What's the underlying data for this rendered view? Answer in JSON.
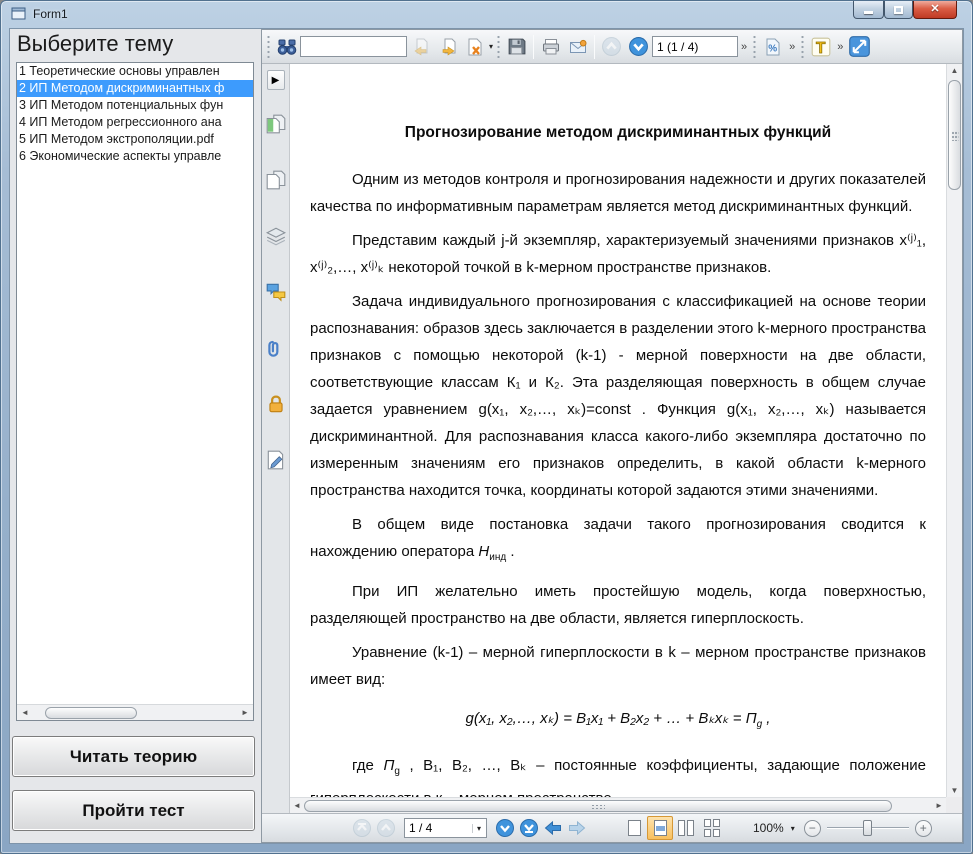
{
  "window": {
    "title": "Form1"
  },
  "sidebar": {
    "heading": "Выберите тему",
    "topics": [
      {
        "label": "1 Теоретические основы управлен",
        "selected": false
      },
      {
        "label": "2 ИП Методом дискриминантных ф",
        "selected": true
      },
      {
        "label": "3 ИП Методом потенциальных фун",
        "selected": false
      },
      {
        "label": "4 ИП Методом регрессионного ана",
        "selected": false
      },
      {
        "label": "5 ИП Методом экстрополяции.pdf",
        "selected": false
      },
      {
        "label": "6 Экономические аспекты управле",
        "selected": false
      }
    ],
    "read_theory_button": "Читать теорию",
    "take_test_button": "Пройти тест"
  },
  "viewer": {
    "toolbar": {
      "search_value": "",
      "page_field": "1 (1 / 4)",
      "chevron": "»",
      "dropdown": "▾"
    },
    "statusbar": {
      "page_combo": "1 / 4",
      "zoom_level": "100%",
      "dropdown": "▾"
    },
    "scroll": {
      "up": "▲",
      "down": "▼",
      "left": "◄",
      "right": "►"
    },
    "icons": {
      "find": "binoculars",
      "text_tool": "T"
    },
    "window_glyphs": {
      "close": "✕"
    }
  },
  "document": {
    "title": "Прогнозирование методом дискриминантных функций",
    "p1": "Одним из методов контроля и прогнозирования надежности и других показателей качества по информативным параметрам является метод дискриминантных функций.",
    "p2": "Представим каждый j-й экземпляр, характеризуемый значениями признаков x⁽ʲ⁾₁, x⁽ʲ⁾₂,…, x⁽ʲ⁾ₖ некоторой точкой в k-мерном пространстве признаков.",
    "p3": "Задача индивидуального прогнозирования с классификацией на основе теории распознавания: образов здесь заключается в разделении этого k-мерного пространства признаков с помощью некоторой (k-1) - мерной поверхности на две области, соответствующие классам К₁ и К₂. Эта разделяющая поверхность в общем случае задается уравнением g(x₁, x₂,…, xₖ)=const . Функция g(x₁, x₂,…, xₖ) называется дискриминантной. Для распознавания класса какого-либо экземпляра достаточно по измеренным значениям его признаков определить, в какой области k-мерного пространства находится точка, координаты которой задаются этими значениями.",
    "p4_pre": "В общем виде постановка задачи такого прогнозирования сводится к нахождению оператора ",
    "p4_operator": "Н",
    "p4_operator_sub": "инд",
    "p4_post": " .",
    "p5": "При ИП желательно иметь простейшую модель, когда поверхностью, разделяющей пространство на две области, является гиперплоскость.",
    "p6": "Уравнение (k-1) – мерной гиперплоскости в k – мерном пространстве признаков имеет вид:",
    "formula_main": "g(x₁, x₂,…, xₖ) = B₁x₁ + B₂x₂ + … + Bₖxₖ = ",
    "formula_pi": "П",
    "formula_pi_sub": "g",
    "formula_tail": " ,",
    "p7_pre": "где ",
    "p7_pi": "П",
    "p7_pi_sub": "g",
    "p7_rest": " , B₁, B₂, …, Bₖ – постоянные коэффициенты, задающие положение гиперплоскости в к – мерном пространстве."
  },
  "colors": {
    "selection_blue": "#3d9bfd",
    "accent_blue": "#3f93dc",
    "selected_layout_orange": "#f8c05f",
    "close_button_red": "#bf3a24"
  }
}
